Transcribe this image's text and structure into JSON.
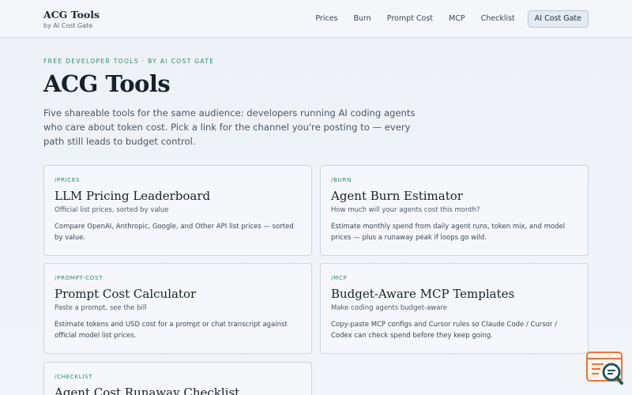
{
  "header": {
    "brand_title": "ACG Tools",
    "brand_sub": "by AI Cost Gate",
    "nav": [
      {
        "label": "Prices"
      },
      {
        "label": "Burn"
      },
      {
        "label": "Prompt Cost"
      },
      {
        "label": "MCP"
      },
      {
        "label": "Checklist"
      },
      {
        "label": "AI Cost Gate"
      }
    ]
  },
  "hero": {
    "eyebrow": "FREE DEVELOPER TOOLS · BY AI COST GATE",
    "title": "ACG Tools",
    "description": "Five shareable tools for the same audience: developers running AI coding agents who care about token cost. Pick a link for the channel you're posting to — every path still leads to budget control."
  },
  "cards": [
    {
      "path": "/PRICES",
      "title": "LLM Pricing Leaderboard",
      "subtitle": "Official list prices, sorted by value",
      "description": "Compare OpenAI, Anthropic, Google, and Other API list prices — sorted by value."
    },
    {
      "path": "/BURN",
      "title": "Agent Burn Estimator",
      "subtitle": "How much will your agents cost this month?",
      "description": "Estimate monthly spend from daily agent runs, token mix, and model prices — plus a runaway peak if loops go wild."
    },
    {
      "path": "/PROMPT-COST",
      "title": "Prompt Cost Calculator",
      "subtitle": "Paste a prompt, see the bill",
      "description": "Estimate tokens and USD cost for a prompt or chat transcript against official model list prices."
    },
    {
      "path": "/MCP",
      "title": "Budget-Aware MCP Templates",
      "subtitle": "Make coding agents budget-aware",
      "description": "Copy-paste MCP configs and Cursor rules so Claude Code / Cursor / Codex can check spend before they keep going."
    },
    {
      "path": "/CHECKLIST",
      "title": "Agent Cost Runaway Checklist",
      "subtitle": "",
      "description": ""
    }
  ],
  "colors": {
    "accent_green": "#2f8a6a",
    "widget_orange": "#e8743b",
    "widget_teal": "#1d5a5e"
  },
  "widget": {
    "icon": "chat-search-icon"
  }
}
